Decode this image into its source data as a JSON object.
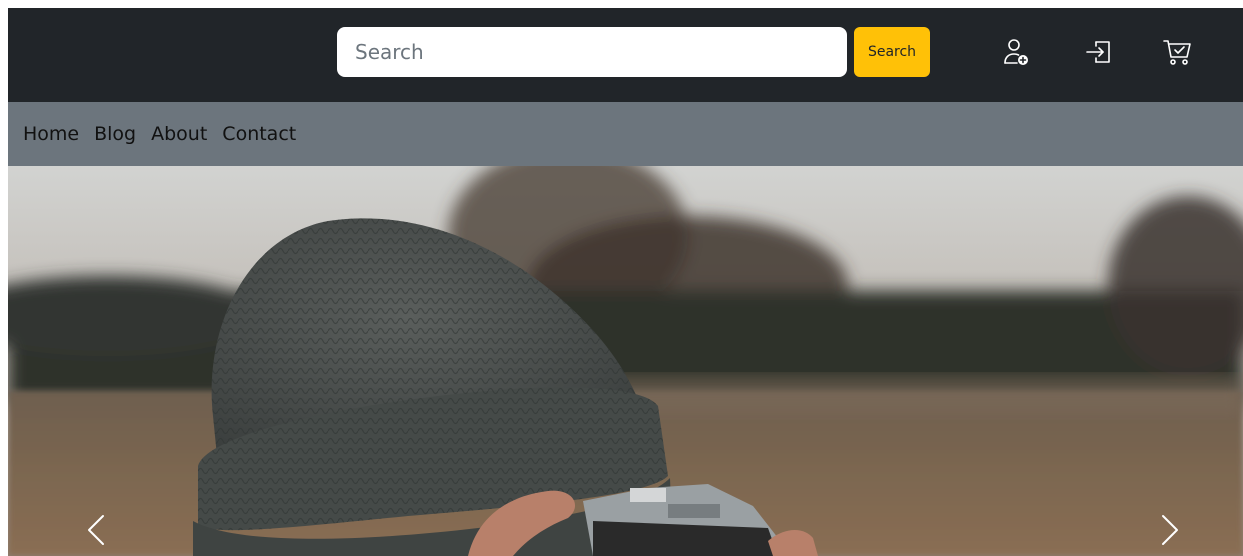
{
  "header": {
    "search": {
      "placeholder": "Search",
      "value": ""
    },
    "search_button_label": "Search",
    "icons": [
      "add-user-icon",
      "login-icon",
      "cart-icon"
    ]
  },
  "nav": {
    "links": [
      {
        "label": "Home"
      },
      {
        "label": "Blog"
      },
      {
        "label": "About"
      },
      {
        "label": "Contact"
      }
    ]
  },
  "carousel": {
    "controls": [
      "chevron-left-icon",
      "chevron-right-icon"
    ]
  },
  "colors": {
    "topbar": "#212529",
    "navbar": "#6c757d",
    "search_button": "#ffc107"
  }
}
